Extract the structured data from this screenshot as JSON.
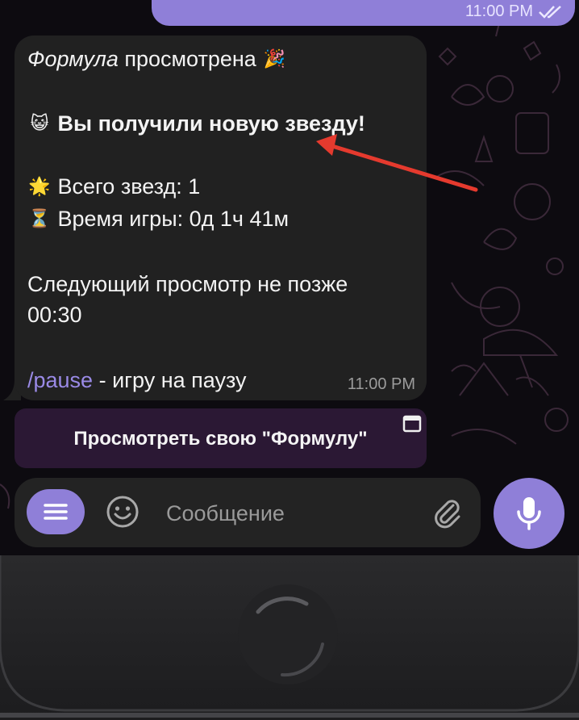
{
  "outgoing_message": {
    "time": "11:00 PM",
    "status_icon": "double-check-icon"
  },
  "message": {
    "line1_italic": "Формула",
    "line1_rest": " просмотрена",
    "line1_emoji": "🎉",
    "line2_emoji": "😺",
    "line2_text": "Вы получили новую звезду!",
    "line3_emoji": "🌟",
    "line3_text": "Всего звезд: 1",
    "line4_emoji": "⏳",
    "line4_text": "Время игры: 0д 1ч 41м",
    "line5_text": "Следующий просмотр не позже",
    "line6_text": "00:30",
    "command_link": "/pause",
    "command_rest": " - игру на паузу",
    "time": "11:00 PM"
  },
  "inline_button": {
    "label": "Просмотреть свою \"Формулу\"",
    "icon": "webapp-window-icon"
  },
  "composer": {
    "placeholder": "Сообщение",
    "menu_icon": "menu-icon",
    "emoji_icon": "smiley-icon",
    "attach_icon": "paperclip-icon",
    "mic_icon": "microphone-icon"
  },
  "colors": {
    "accent": "#8f7fd8",
    "link": "#9a8ae6",
    "bubble": "#212121",
    "keyboard_button": "#2b1834",
    "annotation_arrow": "#e53a2e"
  }
}
